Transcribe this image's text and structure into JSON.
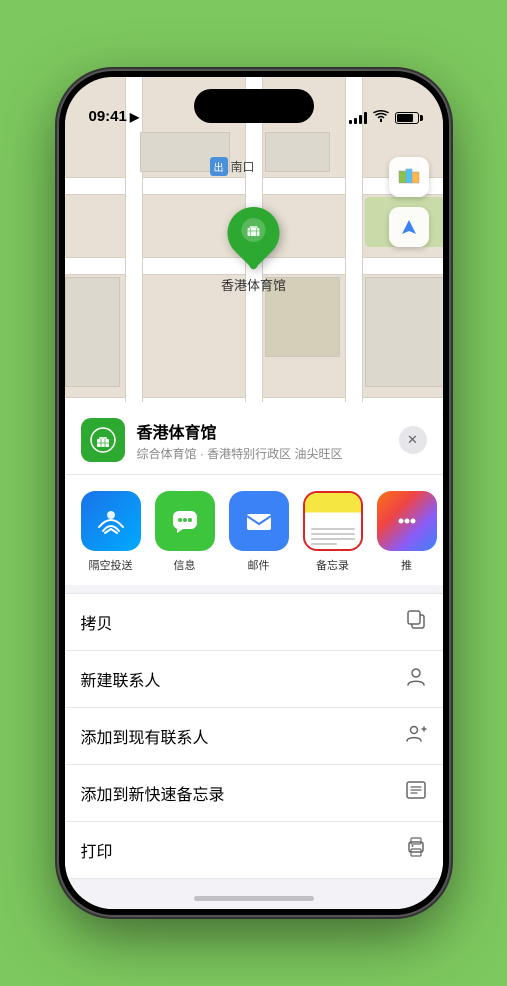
{
  "statusBar": {
    "time": "09:41",
    "locationIcon": "▶"
  },
  "map": {
    "label": "南口",
    "labelTag": "出",
    "markerName": "香港体育馆",
    "controls": {
      "mapIcon": "🗺",
      "locationIcon": "➤"
    }
  },
  "venueCard": {
    "name": "香港体育馆",
    "subtitle": "综合体育馆 · 香港特别行政区 油尖旺区",
    "closeLabel": "✕"
  },
  "shareRow": {
    "items": [
      {
        "id": "airdrop",
        "label": "隔空投送"
      },
      {
        "id": "message",
        "label": "信息"
      },
      {
        "id": "mail",
        "label": "邮件"
      },
      {
        "id": "notes",
        "label": "备忘录"
      },
      {
        "id": "more",
        "label": "推"
      }
    ]
  },
  "actionItems": [
    {
      "id": "copy",
      "label": "拷贝",
      "icon": "⎘"
    },
    {
      "id": "new-contact",
      "label": "新建联系人",
      "icon": "👤"
    },
    {
      "id": "add-existing",
      "label": "添加到现有联系人",
      "icon": "👤"
    },
    {
      "id": "quick-note",
      "label": "添加到新快速备忘录",
      "icon": "📝"
    },
    {
      "id": "print",
      "label": "打印",
      "icon": "🖨"
    }
  ]
}
